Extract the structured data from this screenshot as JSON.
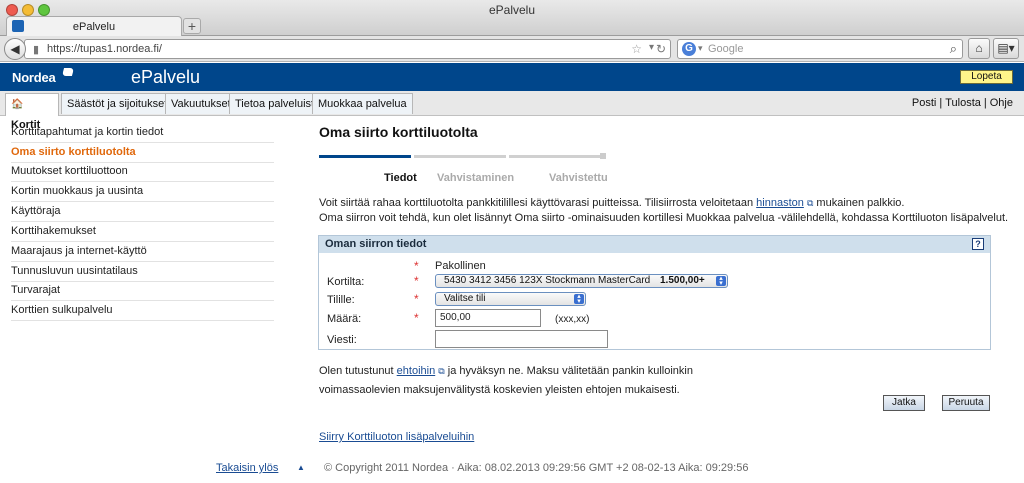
{
  "browser": {
    "window_title": "ePalvelu",
    "tab_title": "ePalvelu",
    "new_tab": "+",
    "url": "https://tupas1.nordea.fi/",
    "search_placeholder": "Google",
    "search_engine": "G"
  },
  "header": {
    "logo": "Nordea",
    "app_title": "ePalvelu",
    "logout": "Lopeta"
  },
  "tabs": [
    {
      "label": "Kortit"
    },
    {
      "label": "Säästöt ja sijoitukset"
    },
    {
      "label": "Vakuutukset"
    },
    {
      "label": "Tietoa palveluista"
    },
    {
      "label": "Muokkaa palvelua"
    }
  ],
  "util_links": [
    "Posti",
    "Tulosta",
    "Ohje"
  ],
  "sidebar": {
    "items": [
      {
        "label": "Korttitapahtumat ja kortin tiedot"
      },
      {
        "label": "Oma siirto korttiluotolta"
      },
      {
        "label": "Muutokset korttiluottoon"
      },
      {
        "label": "Kortin muokkaus ja uusinta"
      },
      {
        "label": "Käyttöraja"
      },
      {
        "label": "Korttihakemukset"
      },
      {
        "label": "Maarajaus ja internet-käyttö"
      },
      {
        "label": "Tunnusluvun uusintatilaus"
      },
      {
        "label": "Turvarajat"
      },
      {
        "label": "Korttien sulkupalvelu"
      }
    ]
  },
  "main": {
    "title": "Oma siirto korttiluotolta",
    "steps": [
      {
        "label": "Tiedot"
      },
      {
        "label": "Vahvistaminen"
      },
      {
        "label": "Vahvistettu"
      }
    ],
    "intro_line1_a": "Voit siirtää rahaa korttiluotolta pankkitilillesi käyttövarasi puitteissa. Tilisiirrosta veloitetaan ",
    "intro_link": "hinnaston",
    "intro_line1_b": " mukainen palkkio.",
    "intro_line2": "Oma siirron voit tehdä, kun olet lisännyt Oma siirto -ominaisuuden kortillesi Muokkaa palvelua -välilehdellä, kohdassa Korttiluoton lisäpalvelut.",
    "form": {
      "heading": "Oman siirron tiedot",
      "help": "?",
      "required_mark": "*",
      "required_note": "Pakollinen",
      "card_label": "Kortilta:",
      "card_value": "5430 3412 3456 123X  Stockmann MasterCard",
      "card_amount": "1.500,00+",
      "account_label": "Tilille:",
      "account_value": "Valitse tili",
      "amount_label": "Määrä:",
      "amount_value": "500,00",
      "amount_hint": "(xxx,xx)",
      "message_label": "Viesti:",
      "message_value": ""
    },
    "terms_a": "Olen tutustunut ",
    "terms_link": "ehtoihin",
    "terms_b": " ja hyväksyn ne. Maksu välitetään pankin kulloinkin",
    "terms_line2": "voimassaolevien maksujenvälitystä koskevien yleisten ehtojen mukaisesti.",
    "continue": "Jatka",
    "cancel": "Peruuta",
    "bottom_link": "Siirry Korttiluoton lisäpalveluihin"
  },
  "footer": {
    "back_to_top": "Takaisin ylös",
    "copyright": "© Copyright 2011 Nordea · Aika: 08.02.2013 09:29:56 GMT +2 08-02-13 Aika: 09:29:56"
  },
  "colors": {
    "brand_blue": "#00468b",
    "active_orange": "#e0680c",
    "logout_yellow": "#fff58a",
    "panel_head": "#cfdfec"
  }
}
